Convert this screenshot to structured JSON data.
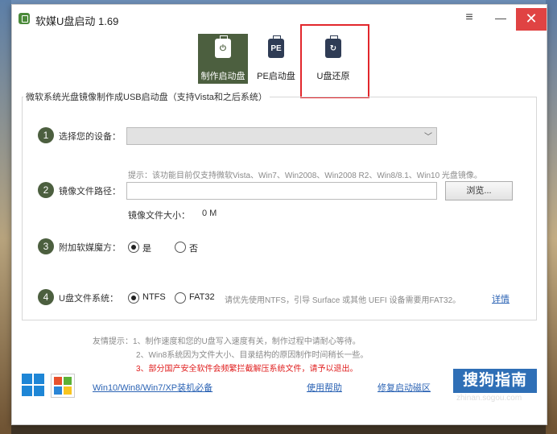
{
  "window": {
    "title": "软媒U盘启动 1.69",
    "menu_glyph": "≡",
    "minimize_glyph": "—",
    "close_glyph": "✕"
  },
  "tabs": [
    {
      "label": "制作启动盘",
      "glyph": "⏻",
      "icon": "usb-power-icon",
      "active": true
    },
    {
      "label": "PE启动盘",
      "glyph": "PE",
      "icon": "usb-pe-icon",
      "active": false
    },
    {
      "label": "U盘还原",
      "glyph": "↻",
      "icon": "usb-restore-icon",
      "active": false
    }
  ],
  "panel": {
    "title": "微软系统光盘镜像制作成USB启动盘（支持Vista和之后系统）",
    "steps": [
      {
        "number": "1",
        "label": "选择您的设备："
      },
      {
        "number": "2",
        "label": "镜像文件路径："
      },
      {
        "number": "3",
        "label": "附加软媒魔方："
      },
      {
        "number": "4",
        "label": "U盘文件系统："
      }
    ],
    "device_select": {
      "value": "",
      "chevron": "﹀"
    },
    "hint": "提示：该功能目前仅支持微软Vista、Win7、Win2008、Win2008 R2、Win8/8.1、Win10 光盘镜像。",
    "image_path": {
      "value": ""
    },
    "browse_label": "浏览...",
    "image_size_label": "镜像文件大小：",
    "image_size_value": "0 M",
    "addon": {
      "yes": "是",
      "no": "否",
      "selected": "yes"
    },
    "filesystem": {
      "ntfs": "NTFS",
      "fat32": "FAT32",
      "selected": "ntfs",
      "note": "请优先使用NTFS，引导 Surface 或其他 UEFI 设备需要用FAT32。",
      "detail_link": "详情"
    }
  },
  "tips": {
    "line1": "友情提示：1、制作速度和您的U盘写入速度有关，制作过程中请耐心等待。",
    "line2": "2、Win8系统因为文件大小、目录结构的原因制作时间稍长一些。",
    "line3": "3、部分国产安全软件会频繁拦截解压系统文件，请予以退出。"
  },
  "footer": {
    "os_link": "Win10/Win8/Win7/XP装机必备",
    "help_link": "使用帮助",
    "repair_link": "修复启动磁区"
  },
  "watermark": {
    "brand": "搜狗指南",
    "url": "zhinan.sogou.com"
  },
  "colors": {
    "accent": "#4c5f3f",
    "close": "#e04343",
    "highlight": "#e2272c",
    "link": "#2b63b4",
    "warning": "#e02020"
  }
}
